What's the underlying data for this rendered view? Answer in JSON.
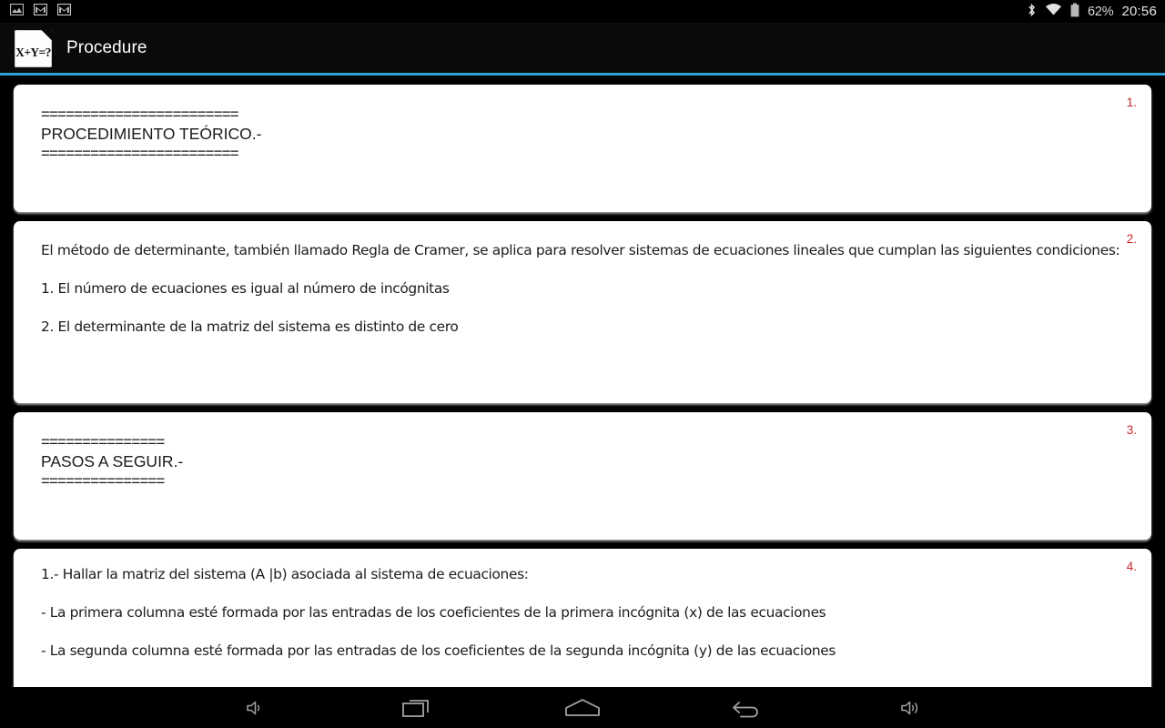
{
  "status_bar": {
    "left_icons": [
      {
        "name": "screenshot-icon",
        "label": "screenshot"
      },
      {
        "name": "gmail-icon-1",
        "label": "M"
      },
      {
        "name": "gmail-icon-2",
        "label": "M"
      }
    ],
    "bluetooth_icon": "bluetooth-icon",
    "wifi_icon": "wifi-icon",
    "battery_icon": "battery-icon",
    "battery_percent": "62%",
    "clock": "20:56"
  },
  "app_bar": {
    "icon_name": "document-equation-icon",
    "icon_text": "X+Y=?",
    "title": "Procedure",
    "accent_color": "#2f9fd4"
  },
  "cards": [
    {
      "index": "1.",
      "type": "heading",
      "rule_top": "========================",
      "heading": "PROCEDIMIENTO TEÓRICO.-",
      "rule_bottom": "========================"
    },
    {
      "index": "2.",
      "type": "body",
      "paragraphs": [
        "El método de determinante, también llamado Regla de Cramer, se aplica para resolver sistemas de ecuaciones lineales que cumplan las siguientes condiciones:",
        "1. El número de ecuaciones es igual al número de incógnitas",
        "2. El determinante de la matriz del sistema es distinto de cero"
      ]
    },
    {
      "index": "3.",
      "type": "heading",
      "rule_top": "===============",
      "heading": "PASOS A SEGUIR.-",
      "rule_bottom": "==============="
    },
    {
      "index": "4.",
      "type": "body",
      "paragraphs": [
        "1.- Hallar la matriz del sistema (A  |b) asociada al sistema de ecuaciones:",
        "- La primera columna esté formada por las entradas de los coeficientes de la primera incógnita (x) de las ecuaciones",
        "- La segunda columna esté formada por las entradas de los coeficientes de la segunda incógnita (y) de las ecuaciones"
      ]
    }
  ],
  "nav_bar": {
    "buttons": [
      {
        "name": "volume-down-icon",
        "label": "Volume down"
      },
      {
        "name": "recent-apps-icon",
        "label": "Recent apps"
      },
      {
        "name": "home-icon",
        "label": "Home"
      },
      {
        "name": "back-icon",
        "label": "Back"
      },
      {
        "name": "volume-up-icon",
        "label": "Volume up"
      }
    ]
  },
  "colors": {
    "accent": "#2f9fd4",
    "index_red": "#c62828",
    "card_bg": "#ffffff",
    "background": "#000000"
  }
}
